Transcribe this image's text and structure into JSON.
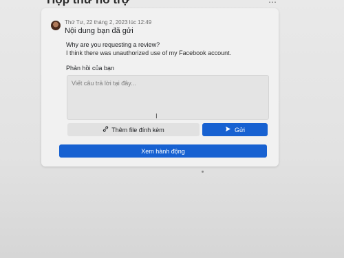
{
  "page": {
    "title": "Hộp thư hỗ trợ",
    "menu_icon": "⋯"
  },
  "message": {
    "timestamp": "Thứ Tư, 22 tháng 2, 2023 lúc 12:49",
    "title": "Nội dung bạn đã gửi",
    "question": "Why are you requesting a review?",
    "answer": "I think there was unauthorized use of my Facebook account."
  },
  "reply": {
    "label": "Phản hồi của bạn",
    "placeholder": "Viết câu trả lời tại đây..."
  },
  "buttons": {
    "attach_label": "Thêm file đính kèm",
    "send_label": "Gửi",
    "view_action_label": "Xem hành động"
  },
  "colors": {
    "primary": "#1761d1",
    "card_bg": "#f1f1f1",
    "input_bg": "#e4e4e4"
  }
}
